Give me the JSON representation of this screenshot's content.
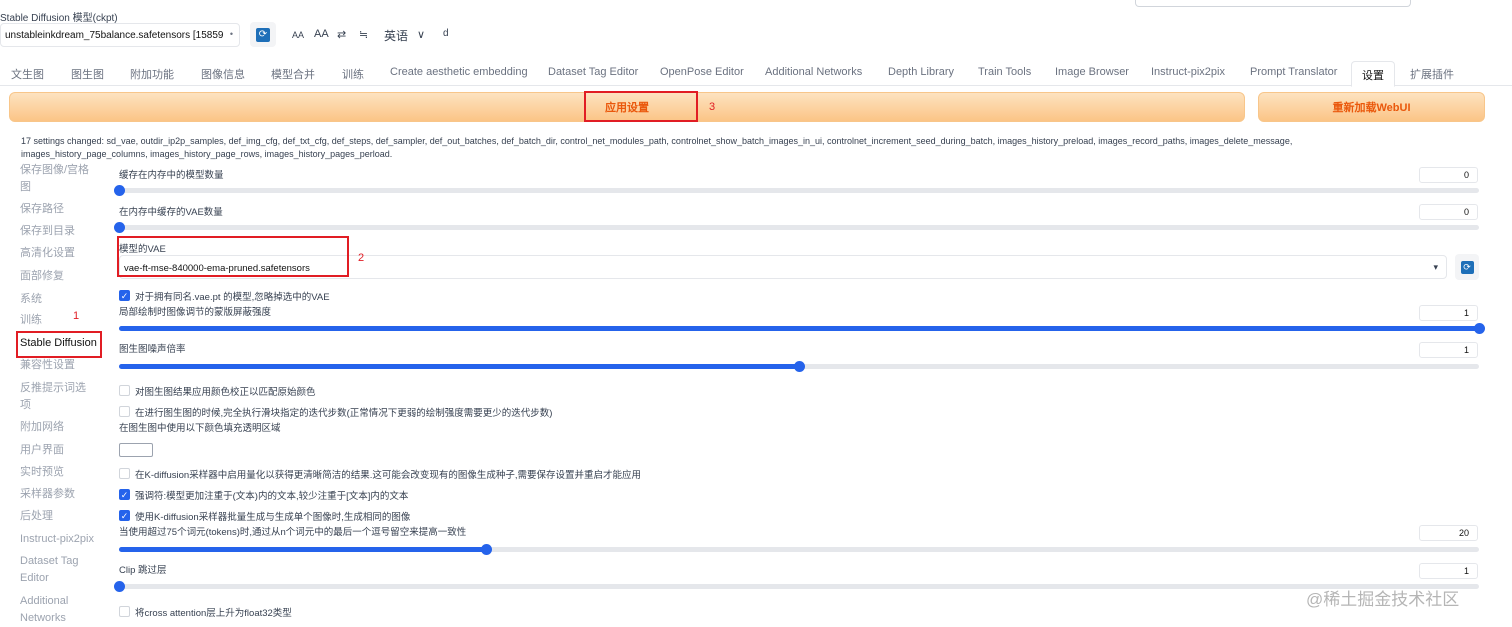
{
  "header": {
    "model_label": "Stable Diffusion 模型(ckpt)",
    "model_value": "unstableinkdream_75balance.safetensors [15859",
    "tools": [
      "AA",
      "AA",
      "⇄",
      "≒",
      "英语",
      "∨",
      "d"
    ]
  },
  "tabs": [
    "文生图",
    "图生图",
    "附加功能",
    "图像信息",
    "模型合并",
    "训练",
    "Create aesthetic embedding",
    "Dataset Tag Editor",
    "OpenPose Editor",
    "Additional Networks",
    "Depth Library",
    "Train Tools",
    "Image Browser",
    "Instruct-pix2pix",
    "Prompt Translator",
    "设置",
    "扩展插件"
  ],
  "buttons": {
    "apply": "应用设置",
    "reload": "重新加载WebUI"
  },
  "annotations": {
    "n1": "1",
    "n2": "2",
    "n3": "3"
  },
  "changed_text": "17 settings changed: sd_vae, outdir_ip2p_samples, def_img_cfg, def_txt_cfg, def_steps, def_sampler, def_out_batches, def_batch_dir, control_net_modules_path, controlnet_show_batch_images_in_ui, controlnet_increment_seed_during_batch, images_history_preload, images_record_paths, images_delete_message, images_history_page_columns, images_history_page_rows, images_history_pages_perload.",
  "sidebar": [
    "保存图像/宫格图",
    "保存路径",
    "保存到目录",
    "高清化设置",
    "面部修复",
    "系统",
    "训练",
    "Stable Diffusion",
    "兼容性设置",
    "反推提示词选项",
    "附加网络",
    "用户界面",
    "实时预览",
    "采样器参数",
    "后处理",
    "Instruct-pix2pix",
    "Dataset Tag Editor",
    "Additional Networks"
  ],
  "settings": {
    "cache_models_label": "缓存在内存中的模型数量",
    "cache_models_value": "0",
    "cache_models_level": 0,
    "cache_vae_label": "在内存中缓存的VAE数量",
    "cache_vae_value": "0",
    "cache_vae_level": 0,
    "vae_label": "模型的VAE",
    "vae_value": "vae-ft-mse-840000-ema-pruned.safetensors",
    "ignore_vae_label": "对于拥有同名.vae.pt 的模型,忽略掉选中的VAE",
    "inpaint_strength_label": "局部绘制时图像调节的蒙版屏蔽强度",
    "inpaint_strength_value": "1",
    "inpaint_strength_level": 1,
    "noise_label": "图生图噪声倍率",
    "noise_value": "1",
    "noise_level": 0.5,
    "color_correction_label": "对图生图结果应用颜色校正以匹配原始颜色",
    "exact_steps_label": "在进行图生图的时候,完全执行滑块指定的迭代步数(正常情况下更弱的绘制强度需要更少的迭代步数)",
    "fill_color_label": "在图生图中使用以下颜色填充透明区域",
    "quantize_label": "在K-diffusion采样器中启用量化以获得更清晰简洁的结果.这可能会改变现有的图像生成种子,需要保存设置并重启才能应用",
    "emphasis_label": "强调符:模型更加注重于(文本)内的文本,较少注重于[文本]内的文本",
    "batch_cond_label": "使用K-diffusion采样器批量生成与生成单个图像时,生成相同的图像",
    "comma_padding_label": "当使用超过75个词元(tokens)时,通过从n个词元中的最后一个逗号留空来提高一致性",
    "comma_padding_value": "20",
    "comma_padding_level": 0.27,
    "clip_skip_label": "Clip 跳过层",
    "clip_skip_value": "1",
    "clip_skip_level": 0,
    "upcast_label": "将cross attention层上升为float32类型"
  },
  "watermark": "@稀土掘金技术社区",
  "colors": {
    "accent": "#2563eb",
    "orange": "#ea580c",
    "annotation_red": "#e11d24"
  }
}
